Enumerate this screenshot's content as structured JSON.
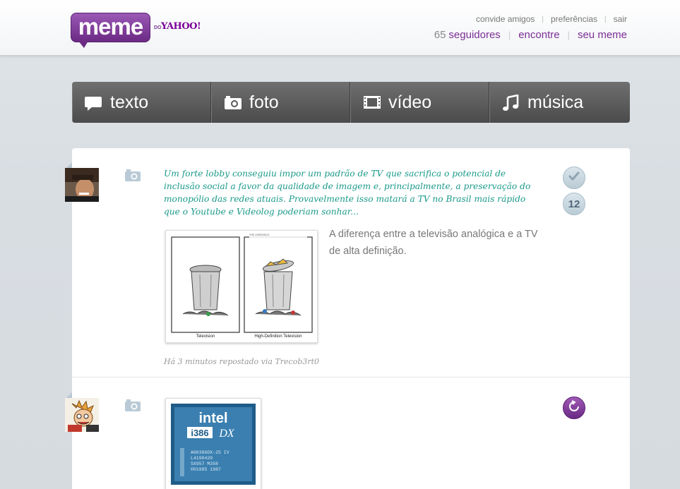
{
  "brand": {
    "logo_text": "meme",
    "do": "DO",
    "yahoo": "YAHOO!",
    "accent": "#7b2e96"
  },
  "header": {
    "top_links": [
      "convide amigos",
      "preferências",
      "sair"
    ],
    "followers_count": "65",
    "followers_label": "seguidores",
    "find_label": "encontre",
    "your_meme_label": "seu meme"
  },
  "nav": {
    "tabs": [
      {
        "label": "texto",
        "icon": "speech-bubble-icon"
      },
      {
        "label": "foto",
        "icon": "camera-icon"
      },
      {
        "label": "vídeo",
        "icon": "film-icon"
      },
      {
        "label": "música",
        "icon": "music-note-icon"
      }
    ]
  },
  "posts": [
    {
      "type_icon": "camera-icon",
      "quote": "Um forte lobby conseguiu impor um padrão de TV que sacrifica o potencial de inclusão social a favor da qualidade de imagem e, principalmente, a preservação do monopólio das redes atuais. Provavelmente isso matará a TV no Brasil mais rápido que o Youtube e Videolog poderiam sonhar...",
      "photo_left_label": "Television",
      "photo_right_label": "High-Definition Television",
      "caption": "A diferença entre a televisão analógica e a TV de alta definição.",
      "meta": "Há 3 minutos repostado via Trecob3rt0",
      "repost_count": "12"
    },
    {
      "type_icon": "camera-icon",
      "chip_brand": "intel",
      "chip_model": "i386",
      "chip_suffix": "DX",
      "chip_lines": [
        "A80386DX-25 IV",
        "L4190420",
        "SX957  M358",
        "©©1985 1987"
      ]
    }
  ]
}
